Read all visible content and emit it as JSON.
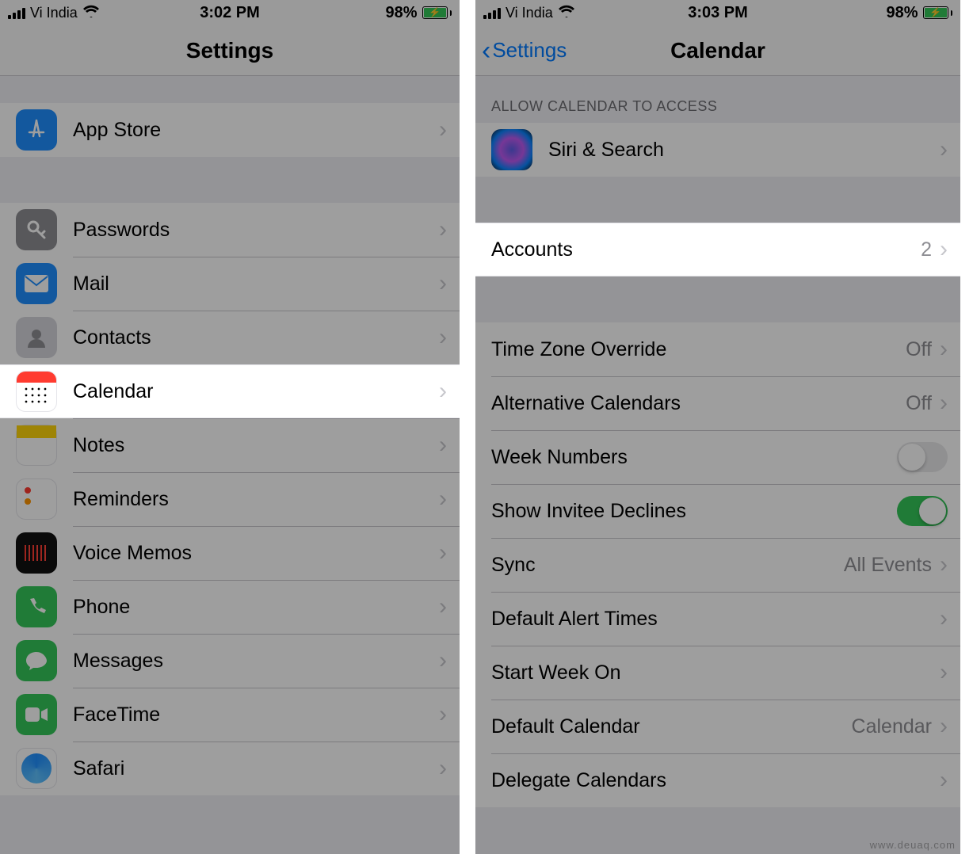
{
  "watermark": "www.deuaq.com",
  "left": {
    "statusbar": {
      "carrier": "Vi India",
      "time": "3:02 PM",
      "battery_pct": "98%"
    },
    "nav": {
      "title": "Settings"
    },
    "rows": {
      "appstore": "App Store",
      "passwords": "Passwords",
      "mail": "Mail",
      "contacts": "Contacts",
      "calendar": "Calendar",
      "notes": "Notes",
      "reminders": "Reminders",
      "voicememos": "Voice Memos",
      "phone": "Phone",
      "messages": "Messages",
      "facetime": "FaceTime",
      "safari": "Safari"
    }
  },
  "right": {
    "statusbar": {
      "carrier": "Vi India",
      "time": "3:03 PM",
      "battery_pct": "98%"
    },
    "nav": {
      "back": "Settings",
      "title": "Calendar"
    },
    "section_header": "ALLOW CALENDAR TO ACCESS",
    "rows": {
      "siri": "Siri & Search",
      "accounts": {
        "label": "Accounts",
        "value": "2"
      },
      "tzoverride": {
        "label": "Time Zone Override",
        "value": "Off"
      },
      "altcal": {
        "label": "Alternative Calendars",
        "value": "Off"
      },
      "weeknumbers": {
        "label": "Week Numbers",
        "on": false
      },
      "invitee": {
        "label": "Show Invitee Declines",
        "on": true
      },
      "sync": {
        "label": "Sync",
        "value": "All Events"
      },
      "defaultalert": {
        "label": "Default Alert Times"
      },
      "startweek": {
        "label": "Start Week On"
      },
      "defaultcal": {
        "label": "Default Calendar",
        "value": "Calendar"
      },
      "delegate": {
        "label": "Delegate Calendars"
      }
    }
  }
}
